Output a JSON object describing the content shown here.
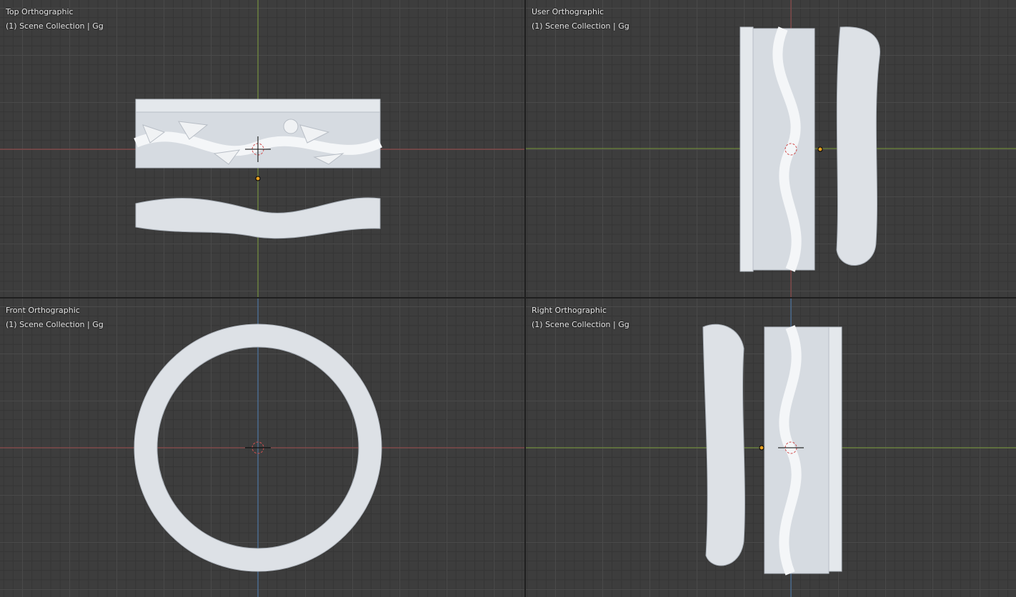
{
  "viewports": [
    {
      "view": "Top Orthographic",
      "collection": "(1) Scene Collection | Gg"
    },
    {
      "view": "User Orthographic",
      "collection": "(1) Scene Collection | Gg"
    },
    {
      "view": "Front Orthographic",
      "collection": "(1) Scene Collection | Gg"
    },
    {
      "view": "Right Orthographic",
      "collection": "(1) Scene Collection | Gg"
    }
  ],
  "colors": {
    "x_axis": "#9a4a4a",
    "y_axis": "#7a9a3a",
    "z_axis": "#4a7ab0",
    "model": "#e4e8ec"
  }
}
